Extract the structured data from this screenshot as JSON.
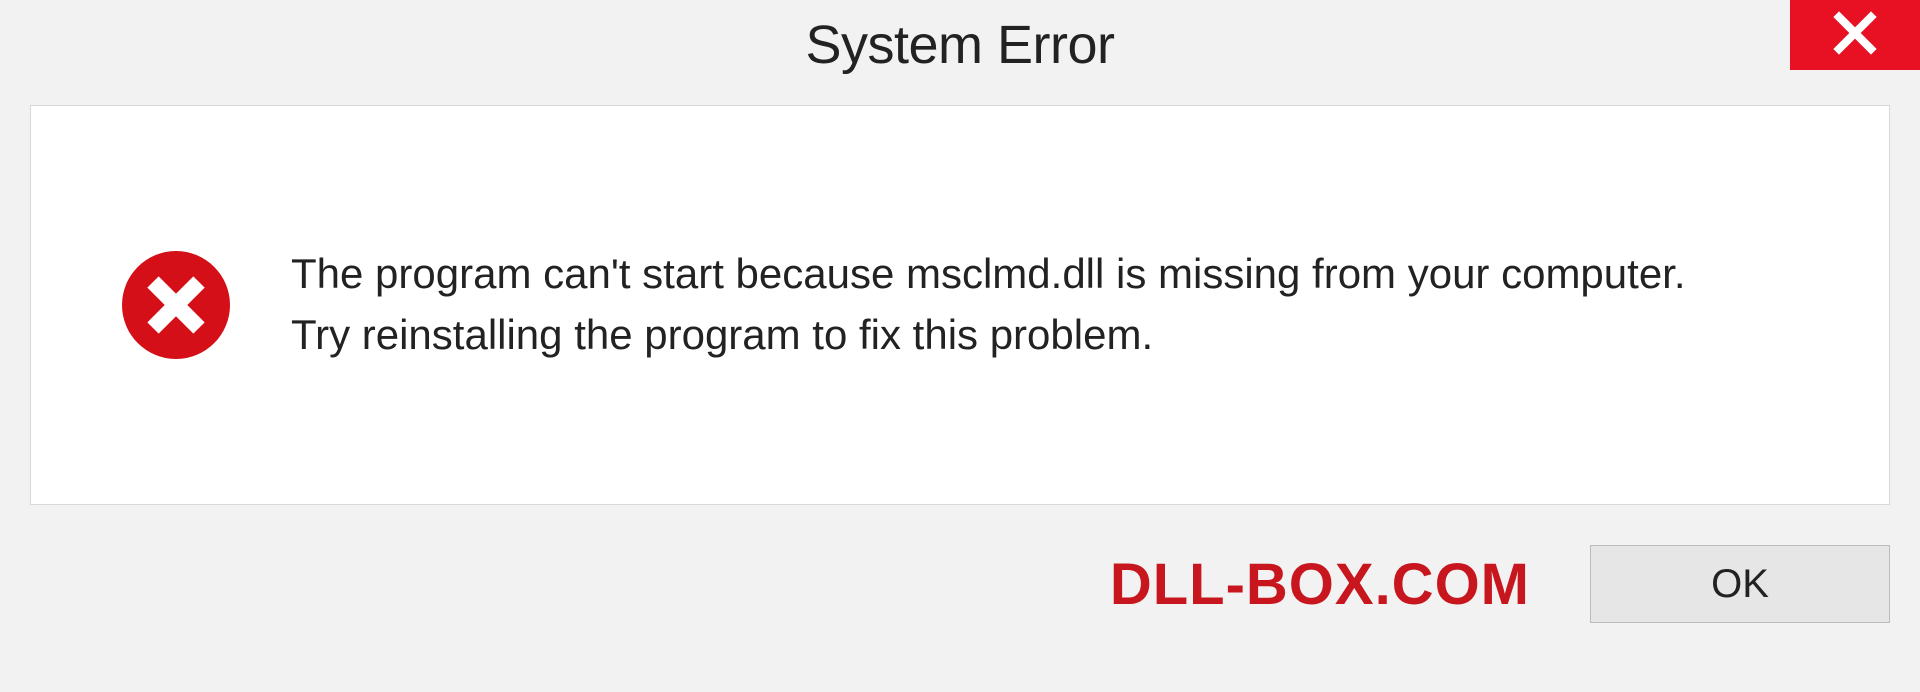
{
  "titlebar": {
    "title": "System Error"
  },
  "message": {
    "line1": "The program can't start because msclmd.dll is missing from your computer.",
    "line2": "Try reinstalling the program to fix this problem."
  },
  "footer": {
    "watermark": "DLL-BOX.COM",
    "ok_label": "OK"
  },
  "colors": {
    "close_bg": "#e81123",
    "error_red": "#d40f17",
    "watermark_red": "#c7161e"
  }
}
